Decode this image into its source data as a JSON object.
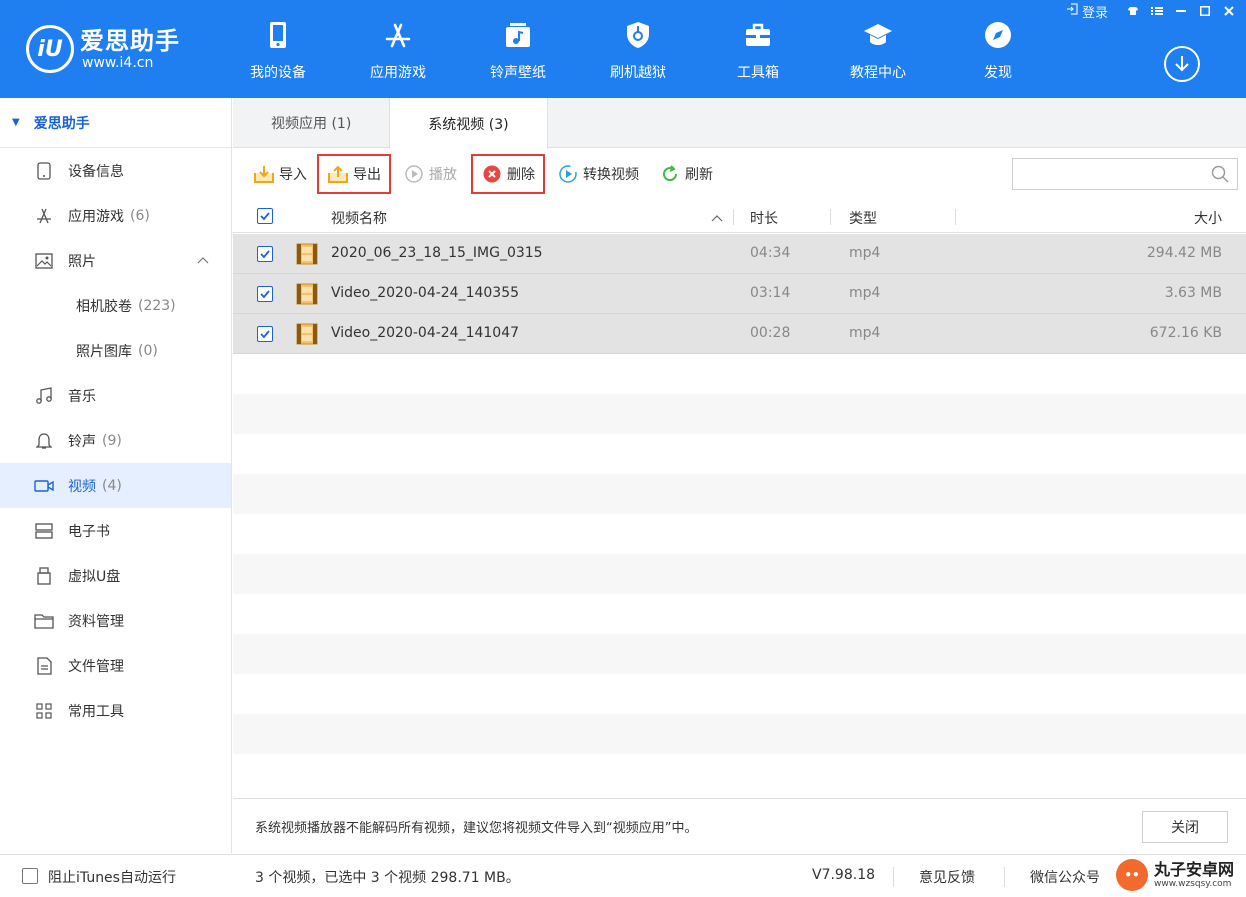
{
  "app": {
    "logo_initial": "iU",
    "logo_name": "爱思助手",
    "logo_url": "www.i4.cn"
  },
  "nav": [
    {
      "label": "我的设备",
      "icon": "phone-icon"
    },
    {
      "label": "应用游戏",
      "icon": "appstore-icon"
    },
    {
      "label": "铃声壁纸",
      "icon": "music-image-icon"
    },
    {
      "label": "刷机越狱",
      "icon": "shield-key-icon"
    },
    {
      "label": "工具箱",
      "icon": "toolbox-icon"
    },
    {
      "label": "教程中心",
      "icon": "graduation-cap-icon"
    },
    {
      "label": "发现",
      "icon": "compass-icon"
    }
  ],
  "window": {
    "login_label": "登录"
  },
  "sidebar": {
    "root_label": "爱思助手",
    "items": [
      {
        "label": "设备信息",
        "count": ""
      },
      {
        "label": "应用游戏",
        "count": "(6)"
      },
      {
        "label": "照片",
        "count": ""
      },
      {
        "label": "相机胶卷",
        "count": "(223)"
      },
      {
        "label": "照片图库",
        "count": "(0)"
      },
      {
        "label": "音乐",
        "count": ""
      },
      {
        "label": "铃声",
        "count": "(9)"
      },
      {
        "label": "视频",
        "count": "(4)"
      },
      {
        "label": "电子书",
        "count": ""
      },
      {
        "label": "虚拟U盘",
        "count": ""
      },
      {
        "label": "资料管理",
        "count": ""
      },
      {
        "label": "文件管理",
        "count": ""
      },
      {
        "label": "常用工具",
        "count": ""
      }
    ]
  },
  "tabs": [
    {
      "label": "视频应用 (1)"
    },
    {
      "label": "系统视频 (3)"
    }
  ],
  "toolbar": {
    "import_label": "导入",
    "export_label": "导出",
    "play_label": "播放",
    "delete_label": "删除",
    "convert_label": "转换视频",
    "refresh_label": "刷新",
    "search_placeholder": ""
  },
  "table": {
    "headers": {
      "name": "视频名称",
      "duration": "时长",
      "type": "类型",
      "size": "大小"
    },
    "rows": [
      {
        "name": "2020_06_23_18_15_IMG_0315",
        "duration": "04:34",
        "type": "mp4",
        "size": "294.42 MB"
      },
      {
        "name": "Video_2020-04-24_140355",
        "duration": "03:14",
        "type": "mp4",
        "size": "3.63 MB"
      },
      {
        "name": "Video_2020-04-24_141047",
        "duration": "00:28",
        "type": "mp4",
        "size": "672.16 KB"
      }
    ]
  },
  "note": {
    "text": "系统视频播放器不能解码所有视频，建议您将视频文件导入到“视频应用”中。",
    "close_label": "关闭"
  },
  "status": {
    "itunes_label": "阻止iTunes自动运行",
    "stats": "3 个视频，已选中 3 个视频 298.71 MB。",
    "version": "V7.98.18",
    "feedback": "意见反馈",
    "wechat": "微信公众号"
  },
  "watermark": {
    "title": "丸子安卓网",
    "url": "www.wzsqsy.com"
  },
  "colors": {
    "brand": "#1f7ef0",
    "accent": "#1a63d6",
    "highlight_box": "#e23b3b"
  }
}
